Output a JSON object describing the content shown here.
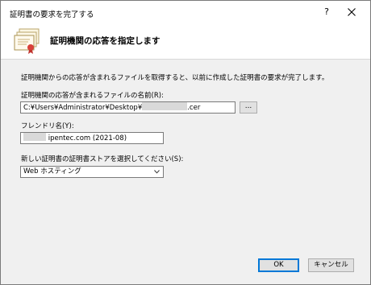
{
  "window": {
    "title": "証明書の要求を完了する",
    "help_glyph": "?",
    "close_icon": "close-icon"
  },
  "header": {
    "icon": "certificate-icon",
    "title": "証明機関の応答を指定します"
  },
  "description": "証明機関からの応答が含まれるファイルを取得すると、以前に作成した証明書の要求が完了します。",
  "file_field": {
    "label": "証明機関の応答が含まれるファイルの名前(R):",
    "value_prefix": "C:¥Users¥Administrator¥Desktop¥",
    "value_suffix": ".cer",
    "browse_label": "..."
  },
  "friendly_name": {
    "label": "フレンドリ名(Y):",
    "value": "ipentec.com (2021-08)"
  },
  "store": {
    "label": "新しい証明書の証明書ストアを選択してください(S):",
    "selected": "Web ホスティング"
  },
  "buttons": {
    "ok": "OK",
    "cancel": "キャンセル"
  }
}
